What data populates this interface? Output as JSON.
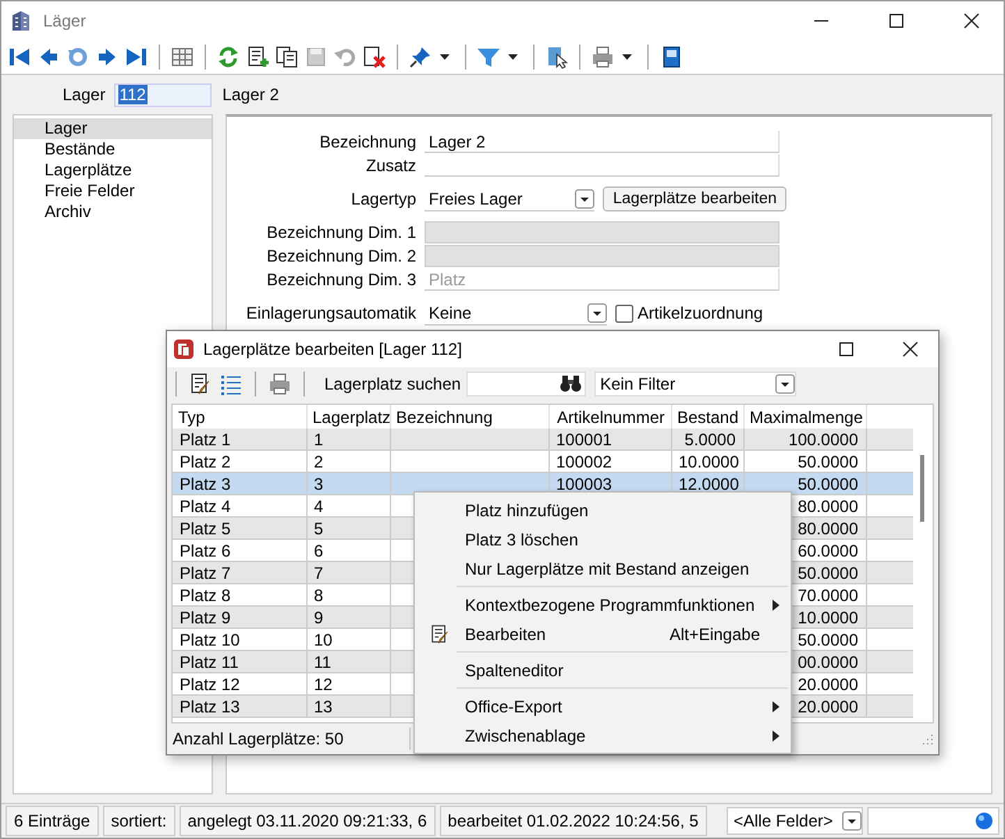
{
  "window": {
    "title": "Läger"
  },
  "lager": {
    "label": "Lager",
    "value": "112",
    "name": "Lager 2"
  },
  "sidebar": {
    "items": [
      {
        "label": "Lager",
        "selected": true
      },
      {
        "label": "Bestände",
        "selected": false
      },
      {
        "label": "Lagerplätze",
        "selected": false
      },
      {
        "label": "Freie Felder",
        "selected": false
      },
      {
        "label": "Archiv",
        "selected": false
      }
    ]
  },
  "form": {
    "groups": [
      [
        {
          "kind": "text",
          "label": "Bezeichnung",
          "value": "Lager 2",
          "disabled": false
        },
        {
          "kind": "text",
          "label": "Zusatz",
          "disabled": false
        }
      ],
      [
        {
          "kind": "select",
          "label": "Lagertyp",
          "value": "Freies Lager",
          "button": "Lagerplätze bearbeiten"
        }
      ],
      [
        {
          "kind": "text",
          "label": "Bezeichnung Dim. 1",
          "disabled": true
        },
        {
          "kind": "text",
          "label": "Bezeichnung Dim. 2",
          "disabled": true
        },
        {
          "kind": "text",
          "label": "Bezeichnung Dim. 3",
          "placeholder": "Platz",
          "disabled": false
        }
      ],
      [
        {
          "kind": "select",
          "label": "Einlagerungsautomatik",
          "value": "Keine",
          "checkbox": {
            "label": "Artikelzuordnung",
            "checked": false
          }
        }
      ]
    ]
  },
  "dialog": {
    "title": "Lagerplätze bearbeiten [Lager 112]",
    "search": {
      "label": "Lagerplatz suchen"
    },
    "filter": {
      "value": "Kein Filter"
    },
    "columns": [
      "Typ",
      "Lagerplatz",
      "Bezeichnung",
      "Artikelnummer",
      "Bestand",
      "Maximalmenge"
    ],
    "rows": [
      {
        "typ": "Platz 1",
        "lagerplatz": "1",
        "artikelnummer": "100001",
        "bestand": "5.0000",
        "maximalmenge": "100.0000",
        "selected": false
      },
      {
        "typ": "Platz 2",
        "lagerplatz": "2",
        "artikelnummer": "100002",
        "bestand": "10.0000",
        "maximalmenge": "50.0000",
        "selected": false
      },
      {
        "typ": "Platz 3",
        "lagerplatz": "3",
        "artikelnummer": "100003",
        "bestand": "12.0000",
        "maximalmenge": "50.0000",
        "selected": true
      },
      {
        "typ": "Platz 4",
        "lagerplatz": "4",
        "maximalmenge": "80.0000",
        "selected": false
      },
      {
        "typ": "Platz 5",
        "lagerplatz": "5",
        "maximalmenge": "80.0000",
        "selected": false
      },
      {
        "typ": "Platz 6",
        "lagerplatz": "6",
        "maximalmenge": "60.0000",
        "selected": false
      },
      {
        "typ": "Platz 7",
        "lagerplatz": "7",
        "maximalmenge": "50.0000",
        "selected": false
      },
      {
        "typ": "Platz 8",
        "lagerplatz": "8",
        "maximalmenge": "70.0000",
        "selected": false
      },
      {
        "typ": "Platz 9",
        "lagerplatz": "9",
        "maximalmenge": "10.0000",
        "selected": false
      },
      {
        "typ": "Platz 10",
        "lagerplatz": "10",
        "maximalmenge": "50.0000",
        "selected": false
      },
      {
        "typ": "Platz 11",
        "lagerplatz": "11",
        "maximalmenge": "00.0000",
        "selected": false
      },
      {
        "typ": "Platz 12",
        "lagerplatz": "12",
        "maximalmenge": "20.0000",
        "selected": false
      },
      {
        "typ": "Platz 13",
        "lagerplatz": "13",
        "maximalmenge": "20.0000",
        "selected": false
      }
    ],
    "footer": "Anzahl Lagerplätze: 50"
  },
  "context_menu": {
    "items": [
      {
        "kind": "item",
        "label": "Platz hinzufügen",
        "submenu": false,
        "icon": false
      },
      {
        "kind": "item",
        "label": "Platz 3 löschen",
        "submenu": false,
        "icon": false
      },
      {
        "kind": "item",
        "label": "Nur Lagerplätze mit Bestand anzeigen",
        "submenu": false,
        "icon": false
      },
      {
        "kind": "separator"
      },
      {
        "kind": "item",
        "label": "Kontextbezogene Programmfunktionen",
        "submenu": true,
        "icon": false
      },
      {
        "kind": "item",
        "label": "Bearbeiten",
        "shortcut": "Alt+Eingabe",
        "submenu": false,
        "icon": true
      },
      {
        "kind": "separator"
      },
      {
        "kind": "item",
        "label": "Spalteneditor",
        "submenu": false,
        "icon": false
      },
      {
        "kind": "separator"
      },
      {
        "kind": "item",
        "label": "Office-Export",
        "submenu": true,
        "icon": false
      },
      {
        "kind": "item",
        "label": "Zwischenablage",
        "submenu": true,
        "icon": false
      }
    ]
  },
  "status_bar": {
    "cells": [
      "6 Einträge",
      "sortiert:",
      "angelegt 03.11.2020 09:21:33,  6",
      "bearbeitet 01.02.2022 10:24:56,  5"
    ],
    "field_filter": {
      "value": "<Alle Felder>"
    }
  }
}
